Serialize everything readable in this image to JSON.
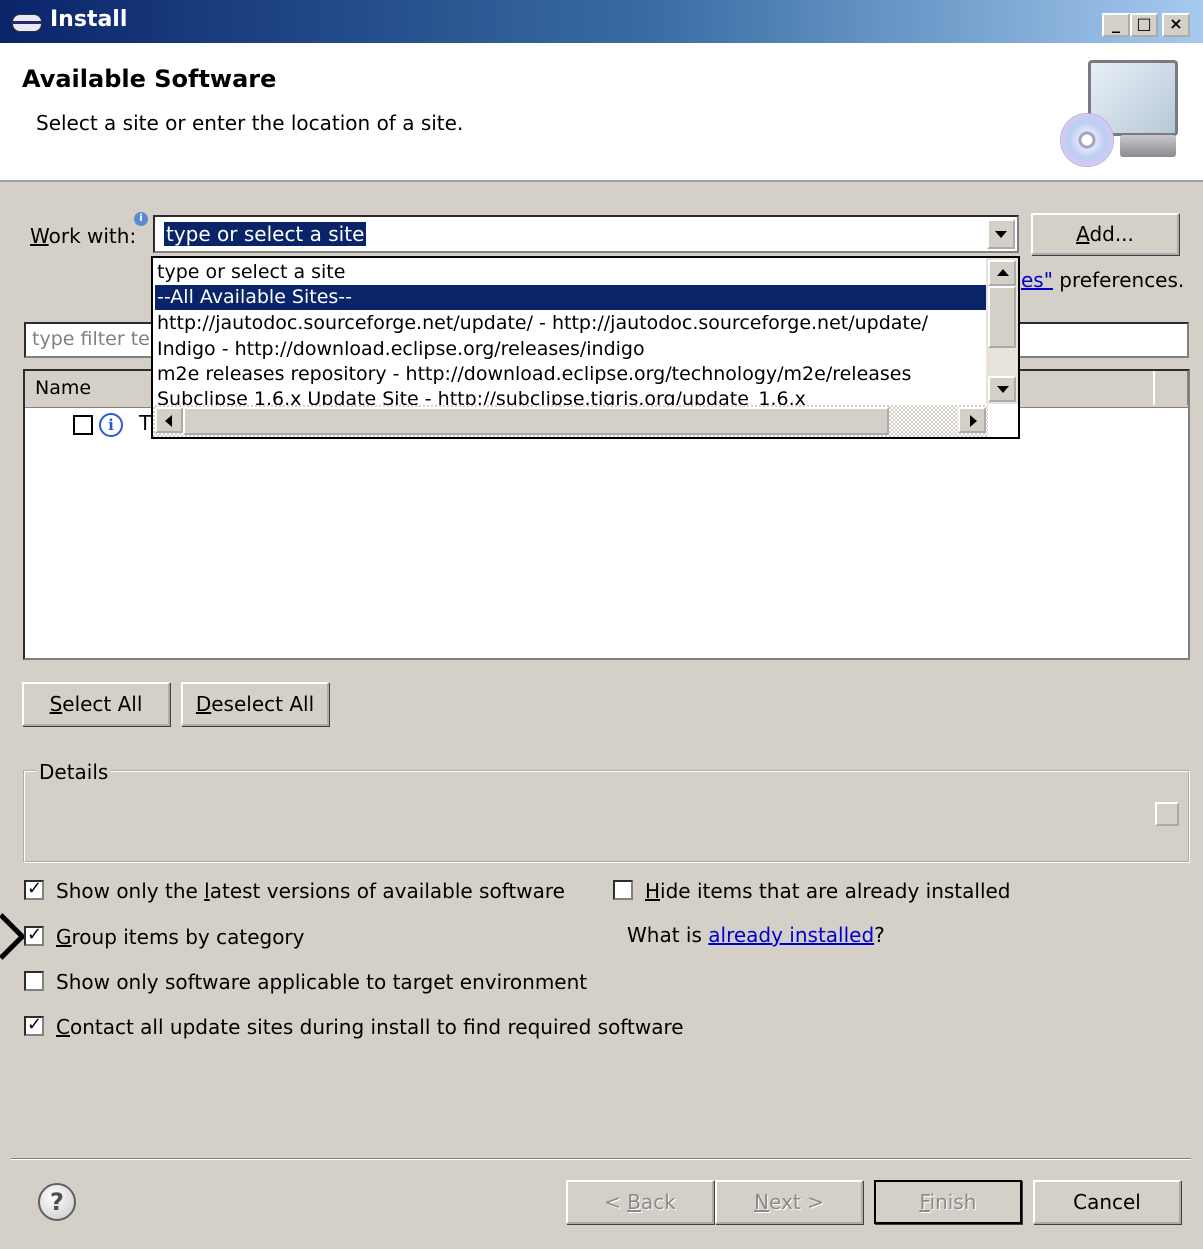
{
  "window": {
    "title": "Install",
    "min": "_",
    "max": "□",
    "close": "×"
  },
  "header": {
    "title": "Available Software",
    "subtitle": "Select a site or enter the location of a site."
  },
  "work_with": {
    "label_u": "W",
    "label_rest": "ork with:",
    "info": "i",
    "value": "type or select a site",
    "add_button": "Add...",
    "prefs_link_tail": "es\"",
    "prefs_text": " preferences."
  },
  "dropdown": {
    "items": [
      "type or select a site",
      "--All Available Sites--",
      "http://jautodoc.sourceforge.net/update/ - http://jautodoc.sourceforge.net/update/",
      "Indigo - http://download.eclipse.org/releases/indigo",
      "m2e releases repository - http://download.eclipse.org/technology/m2e/releases",
      "Subclipse 1.6.x Update Site - http://subclipse.tigris.org/update_1.6.x"
    ]
  },
  "filter": {
    "placeholder": "type filter te"
  },
  "tree": {
    "col_name": "Name",
    "row_text": "T"
  },
  "buttons": {
    "select_all_u": "S",
    "select_all_rest": "elect All",
    "deselect_all_u": "D",
    "deselect_all_rest": "eselect All"
  },
  "details": {
    "label": "Details"
  },
  "options": {
    "latest": {
      "pre": "Show only the ",
      "u": "l",
      "post": "atest versions of available software",
      "checked": true
    },
    "hide": {
      "u": "H",
      "post": "ide items that are already installed",
      "checked": false
    },
    "group": {
      "pre": "",
      "u": "G",
      "post": "roup items by category",
      "checked": true
    },
    "what_is": "What is ",
    "already_installed": "already installed",
    "q": "?",
    "target": {
      "text": "Show only software applicable to target environment",
      "checked": false
    },
    "contact": {
      "u": "C",
      "post": "ontact all update sites during install to find required software",
      "checked": true
    }
  },
  "footer": {
    "help": "?",
    "back": "< Back",
    "back_u": "B",
    "next": "Next >",
    "next_u": "N",
    "finish": "Finish",
    "finish_u": "F",
    "cancel": "Cancel"
  }
}
